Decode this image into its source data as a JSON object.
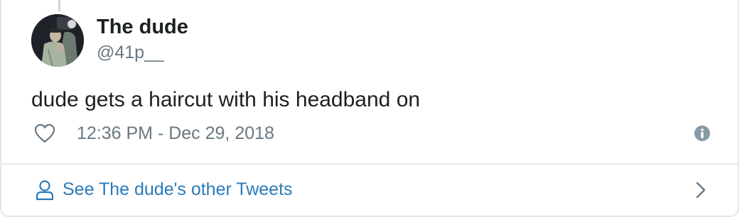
{
  "tweet": {
    "author": {
      "display_name": "The dude",
      "handle": "@41p__",
      "avatar_icon": "profile-photo"
    },
    "text": "dude gets a haircut with his headband on",
    "timestamp": "12:36 PM - Dec 29, 2018",
    "like_icon": "heart-outline-icon",
    "info_icon": "info-icon"
  },
  "footer": {
    "label": "See The dude's other Tweets",
    "person_icon": "person-icon",
    "chevron_icon": "chevron-right-icon"
  },
  "colors": {
    "text": "#1c2022",
    "secondary": "#697882",
    "link": "#2b7bb9",
    "border": "#e1e8ed",
    "info_icon": "#8899a6"
  }
}
